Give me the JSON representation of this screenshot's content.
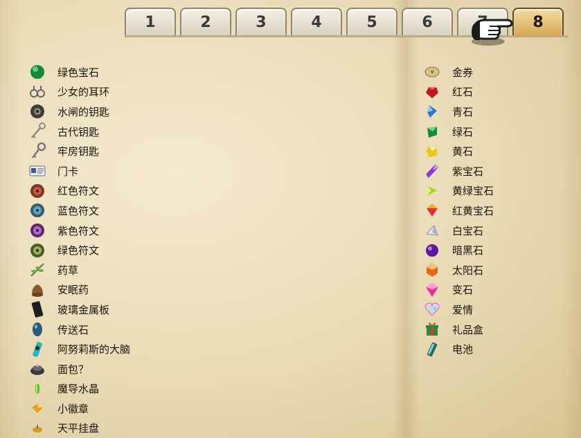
{
  "tabs": [
    {
      "label": "1"
    },
    {
      "label": "2"
    },
    {
      "label": "3"
    },
    {
      "label": "4"
    },
    {
      "label": "5"
    },
    {
      "label": "6"
    },
    {
      "label": "7"
    },
    {
      "label": "8"
    }
  ],
  "active_tab": "8",
  "pointer_icon": "pointing-hand-cursor-icon",
  "left_items": [
    {
      "label": "绿色宝石",
      "icon": "green-gem-icon"
    },
    {
      "label": "少女的耳环",
      "icon": "earrings-icon"
    },
    {
      "label": "水闸的钥匙",
      "icon": "floodgate-key-icon"
    },
    {
      "label": "古代钥匙",
      "icon": "ancient-key-icon"
    },
    {
      "label": "牢房钥匙",
      "icon": "cell-key-icon"
    },
    {
      "label": "门卡",
      "icon": "keycard-icon"
    },
    {
      "label": "红色符文",
      "icon": "red-rune-icon"
    },
    {
      "label": "蓝色符文",
      "icon": "blue-rune-icon"
    },
    {
      "label": "紫色符文",
      "icon": "purple-rune-icon"
    },
    {
      "label": "绿色符文",
      "icon": "green-rune-icon"
    },
    {
      "label": "药草",
      "icon": "herb-icon"
    },
    {
      "label": "安眠药",
      "icon": "sleeping-pill-icon"
    },
    {
      "label": "玻璃金属板",
      "icon": "glass-metal-plate-icon"
    },
    {
      "label": "传送石",
      "icon": "teleport-stone-icon"
    },
    {
      "label": "阿努莉斯的大脑",
      "icon": "brain-jar-icon"
    },
    {
      "label": "面包？",
      "icon": "bread-icon"
    },
    {
      "label": "魔导水晶",
      "icon": "magic-crystal-icon"
    },
    {
      "label": "小徽章",
      "icon": "small-badge-icon"
    },
    {
      "label": "天平挂盘",
      "icon": "scale-pan-icon"
    }
  ],
  "right_items": [
    {
      "label": "金券",
      "icon": "gold-ticket-icon"
    },
    {
      "label": "红石",
      "icon": "red-stone-icon"
    },
    {
      "label": "青石",
      "icon": "blue-stone-icon"
    },
    {
      "label": "绿石",
      "icon": "green-stone-icon"
    },
    {
      "label": "黄石",
      "icon": "yellow-stone-icon"
    },
    {
      "label": "紫宝石",
      "icon": "amethyst-icon"
    },
    {
      "label": "黄绿宝石",
      "icon": "peridot-icon"
    },
    {
      "label": "红黄宝石",
      "icon": "red-yellow-gem-icon"
    },
    {
      "label": "白宝石",
      "icon": "white-gem-icon"
    },
    {
      "label": "暗黑石",
      "icon": "dark-stone-icon"
    },
    {
      "label": "太阳石",
      "icon": "sun-stone-icon"
    },
    {
      "label": "变石",
      "icon": "alexandrite-icon"
    },
    {
      "label": "爱情",
      "icon": "love-crystal-icon"
    },
    {
      "label": "礼品盒",
      "icon": "gift-box-icon"
    },
    {
      "label": "电池",
      "icon": "battery-icon"
    }
  ]
}
